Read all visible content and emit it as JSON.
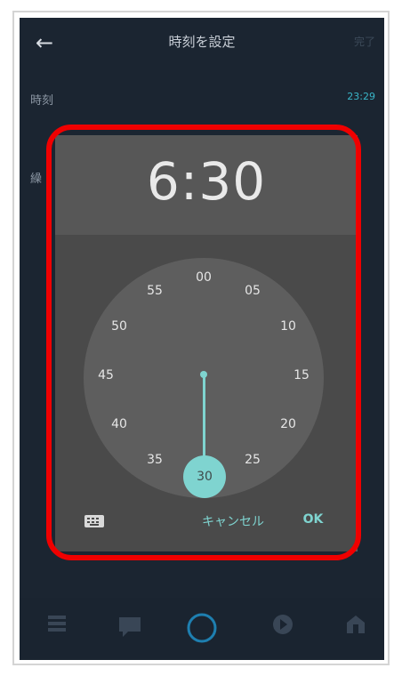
{
  "header": {
    "title": "時刻を設定",
    "right_label": "完了"
  },
  "rows": [
    {
      "label": "時刻",
      "value": "23:29"
    },
    {
      "label": "繰",
      "value": ""
    }
  ],
  "dialog": {
    "time_display": "6:30",
    "minutes": [
      "00",
      "05",
      "10",
      "15",
      "20",
      "25",
      "30",
      "35",
      "40",
      "45",
      "50",
      "55"
    ],
    "selected_minute": "30",
    "cancel_label": "キャンセル",
    "ok_label": "OK"
  },
  "colors": {
    "accent": "#7fd4d0",
    "highlight": "#f00000",
    "background": "#1b2531"
  },
  "icons": [
    "back-arrow-icon",
    "keyboard-icon",
    "nav-list-icon",
    "nav-chat-icon",
    "nav-alexa-icon",
    "nav-play-icon",
    "nav-devices-icon"
  ]
}
